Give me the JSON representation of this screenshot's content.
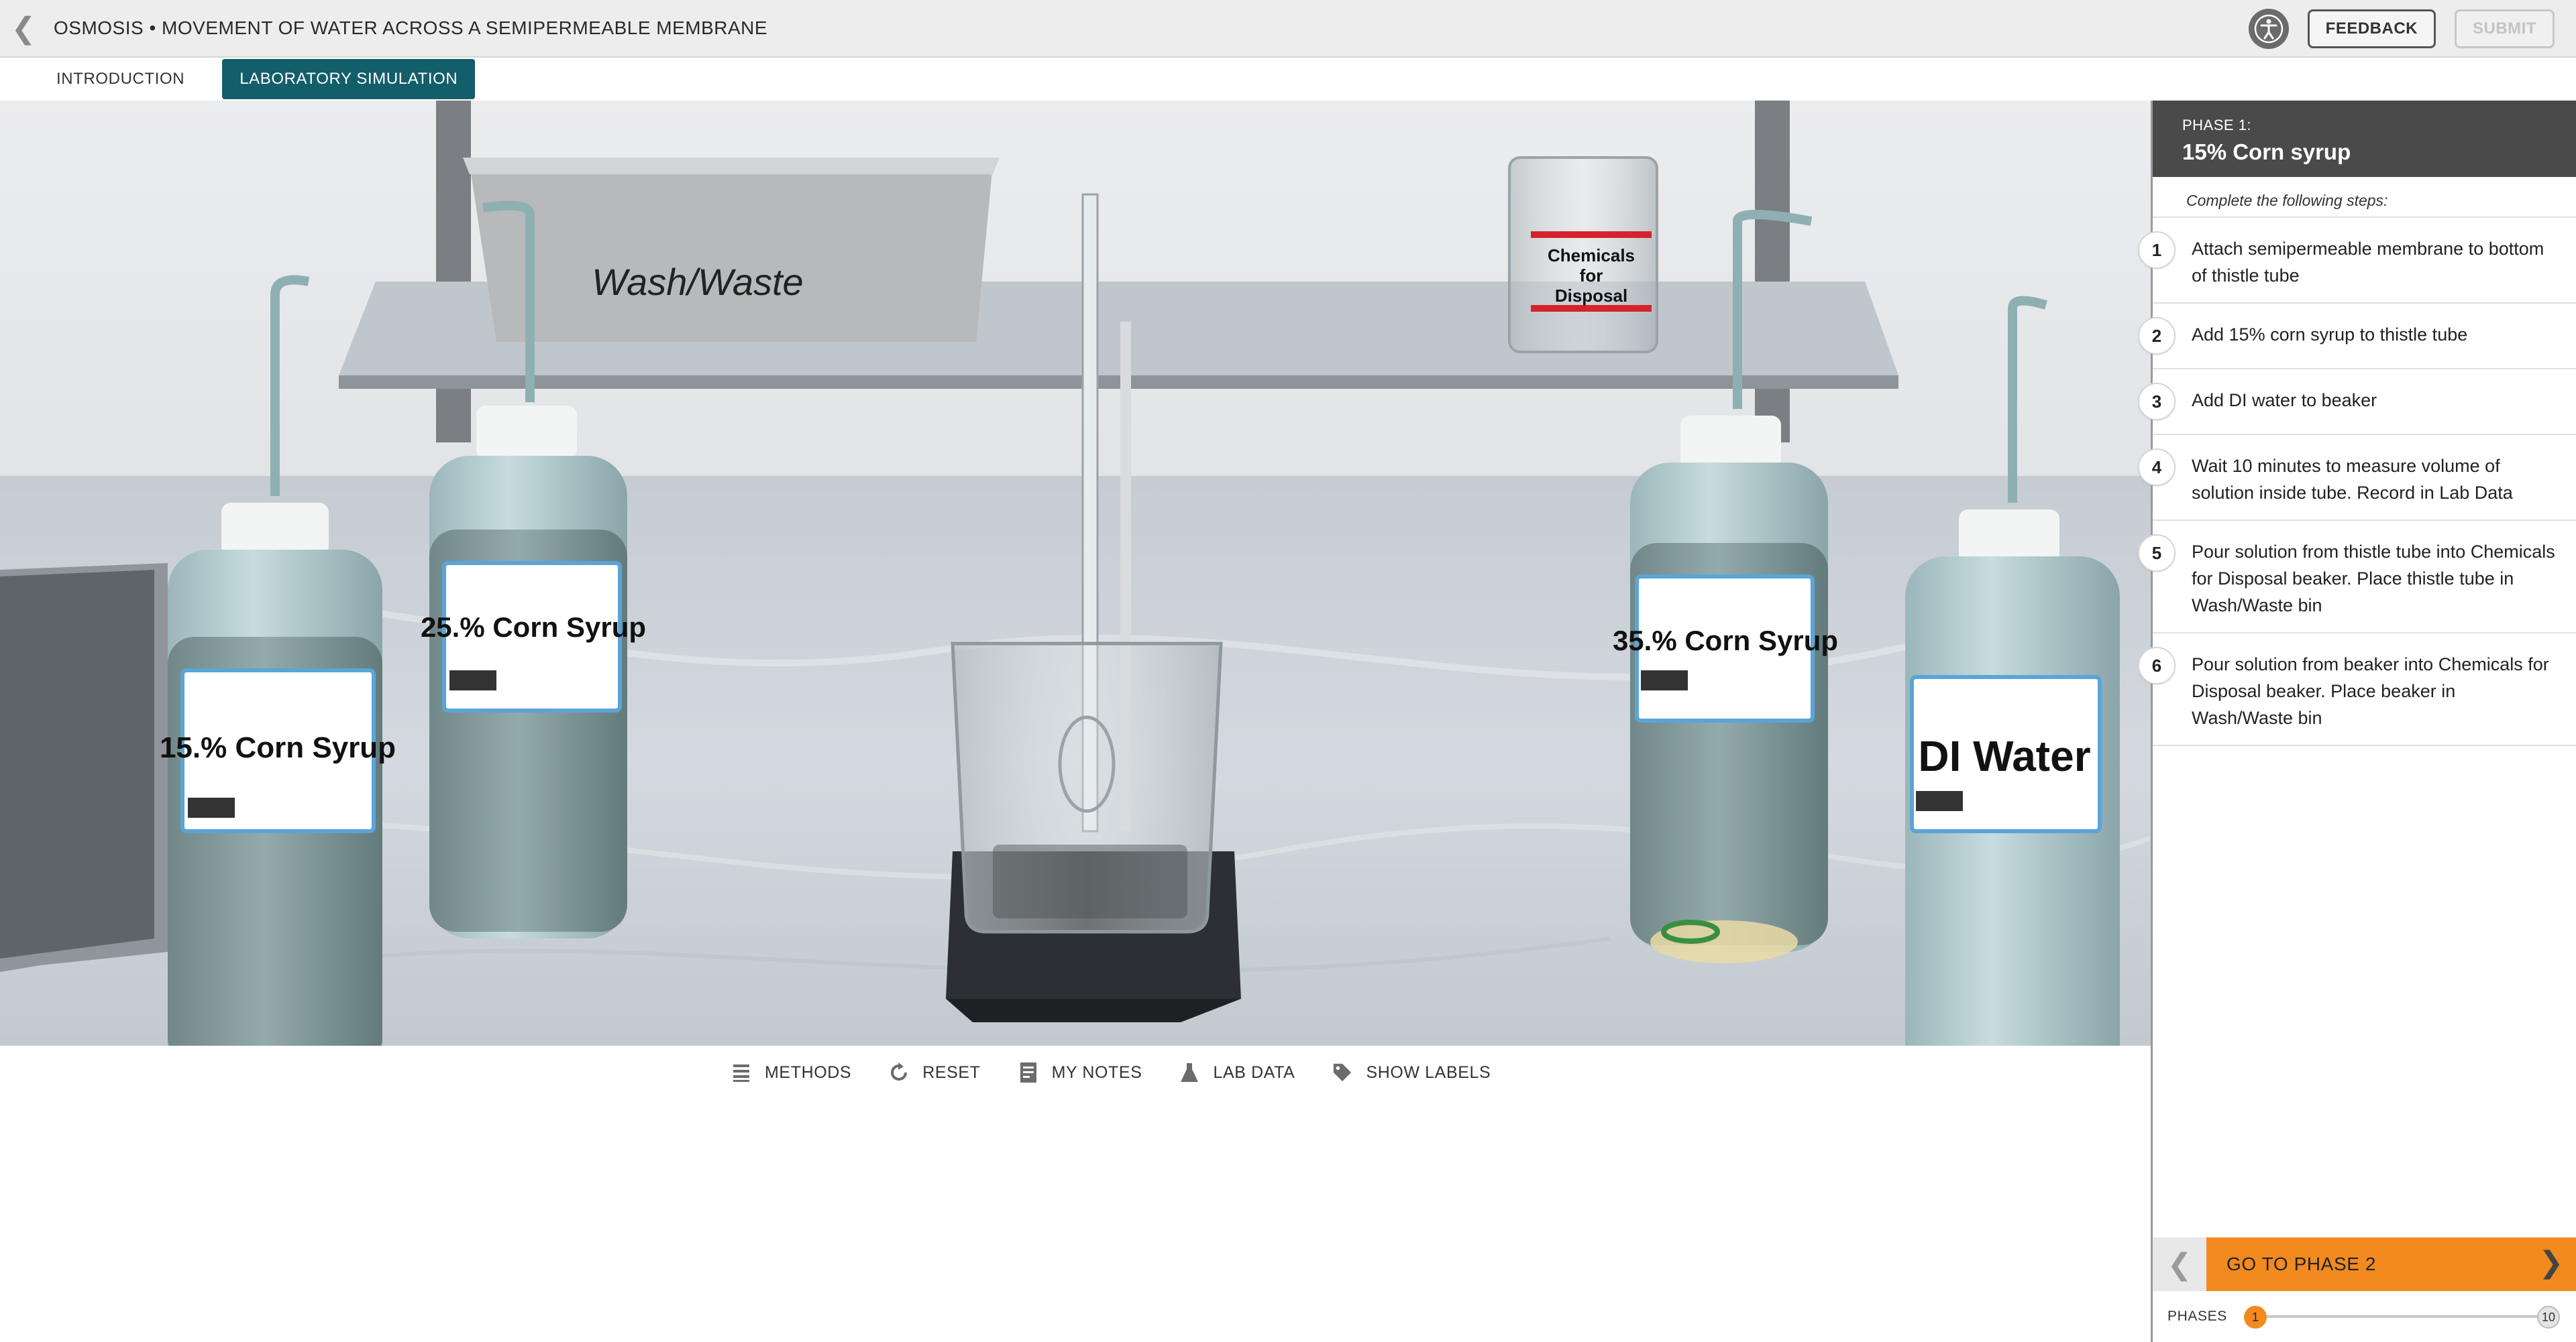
{
  "header": {
    "title": "OSMOSIS • MOVEMENT OF WATER ACROSS A SEMIPERMEABLE MEMBRANE",
    "feedback_label": "FEEDBACK",
    "submit_label": "SUBMIT"
  },
  "tabs": [
    {
      "label": "INTRODUCTION",
      "active": false
    },
    {
      "label": "LABORATORY SIMULATION",
      "active": true
    }
  ],
  "scene": {
    "wash_waste": "Wash/Waste",
    "disposal": [
      "Chemicals",
      "for",
      "Disposal"
    ],
    "bottle_15": "15.% Corn Syrup",
    "bottle_25": "25.% Corn Syrup",
    "bottle_35": "35.% Corn Syrup",
    "bottle_di": "DI Water"
  },
  "toolbar": {
    "methods": "METHODS",
    "reset": "RESET",
    "notes": "MY NOTES",
    "lab_data": "LAB DATA",
    "show_labels": "SHOW LABELS"
  },
  "panel": {
    "phase_sub": "PHASE 1:",
    "phase_title": "15% Corn syrup",
    "intro": "Complete the following steps:",
    "steps": [
      {
        "num": "1",
        "text": "Attach semipermeable membrane to bottom of thistle tube"
      },
      {
        "num": "2",
        "text": "Add 15% corn syrup to thistle tube"
      },
      {
        "num": "3",
        "text": "Add DI water to beaker"
      },
      {
        "num": "4",
        "text": "Wait 10 minutes to measure volume of solution inside tube. Record in Lab Data"
      },
      {
        "num": "5",
        "text": "Pour solution from thistle tube into Chemicals for Disposal beaker. Place thistle tube in Wash/Waste bin"
      },
      {
        "num": "6",
        "text": "Pour solution from beaker into Chemicals for Disposal beaker. Place beaker in Wash/Waste bin"
      }
    ],
    "next_phase": "GO TO PHASE 2",
    "phases_label": "PHASES",
    "phase_start": "1",
    "phase_end": "10"
  },
  "colors": {
    "accent_teal": "#135e6b",
    "accent_orange": "#f28a1f",
    "panel_header": "#4a4a4a"
  }
}
